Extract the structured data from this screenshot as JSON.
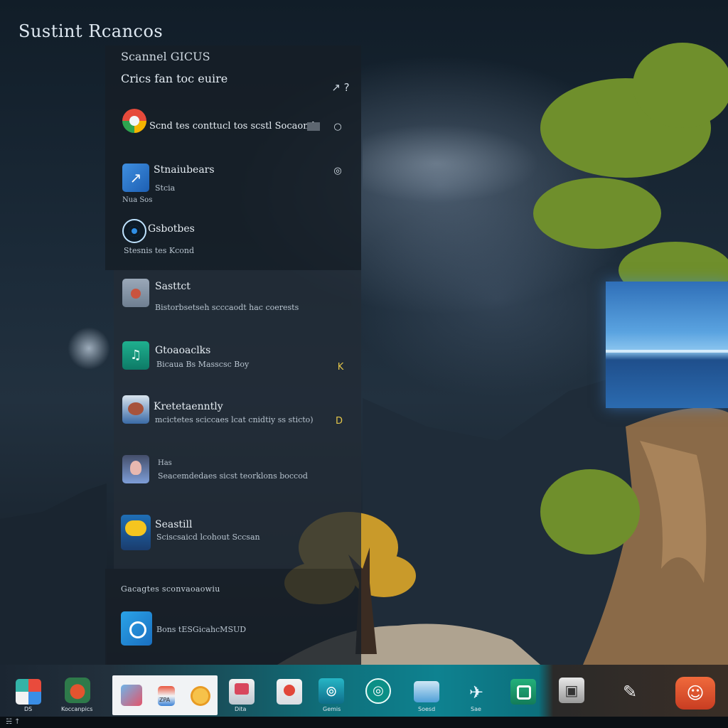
{
  "desktop": {
    "title": "Sustint Rcancos"
  },
  "start_menu": {
    "header_line1": "Scannel GICUS",
    "header_line2": "Crics fan toc euire",
    "header_button_glyph": "↗ ?",
    "items": [
      {
        "title": "Scnd tes  conttucl tos scstl Socaonds",
        "subtitle": "",
        "action_glyph": "○",
        "icon": "google-icon"
      },
      {
        "title": "Stnaiubears",
        "subtitle": "Stcia",
        "extra": "Nua Sos",
        "action_glyph": "◎",
        "icon": "arrow-app-icon"
      },
      {
        "title": "Gsbotbes",
        "subtitle": "Stesnis tes Kcond",
        "action_glyph": "",
        "icon": "eye-icon"
      },
      {
        "title": "Sasttct",
        "subtitle": "Bistorbsetseh scccaodt hac coerests",
        "action_glyph": "",
        "icon": "gray-app-icon"
      },
      {
        "title": "Gtoaoaclks",
        "subtitle": "Bicaua Bs Masscsc Boy",
        "action_glyph": "K",
        "icon": "music-icon"
      },
      {
        "title": "Kretetaenntly",
        "subtitle": "mcictetes sciccaes lcat cnidtiy ss sticto)",
        "action_glyph": "D",
        "icon": "photo-icon"
      },
      {
        "title": "Has",
        "subtitle": "Seacemdedaes sicst  teorklons  boccod",
        "action_glyph": "",
        "icon": "portrait-icon"
      },
      {
        "title": "Seastill",
        "subtitle": "Sciscsaicd lcohout Sccsan",
        "action_glyph": "",
        "icon": "chat-icon"
      }
    ],
    "section_label": "Gacagtes sconvaoaowiu",
    "bottom_item": {
      "title": "Bons  tESGicahcMSUD",
      "icon": "camera-icon"
    }
  },
  "taskbar": {
    "items": [
      {
        "name": "windows-apps-icon",
        "label": "DS"
      },
      {
        "name": "hub-app-icon",
        "label": "Koccanpics"
      },
      {
        "name": "pinned-app-1-icon",
        "label": ""
      },
      {
        "name": "pinned-app-2-icon",
        "label": "ZPA"
      },
      {
        "name": "pinned-app-3-icon",
        "label": ""
      },
      {
        "name": "media-app-icon",
        "label": "Dita"
      },
      {
        "name": "mail-app-icon",
        "label": ""
      },
      {
        "name": "games-app-icon",
        "label": "Gemis"
      },
      {
        "name": "browser-app-icon",
        "label": ""
      },
      {
        "name": "photos-app-icon",
        "label": "Soesd"
      },
      {
        "name": "travel-app-icon",
        "label": "Sae"
      },
      {
        "name": "camera-app-icon",
        "label": ""
      },
      {
        "name": "files-app-icon",
        "label": ""
      },
      {
        "name": "draw-app-icon",
        "label": ""
      },
      {
        "name": "assistant-app-icon",
        "label": ""
      }
    ],
    "bottom_glyph": "☵ ↑"
  }
}
